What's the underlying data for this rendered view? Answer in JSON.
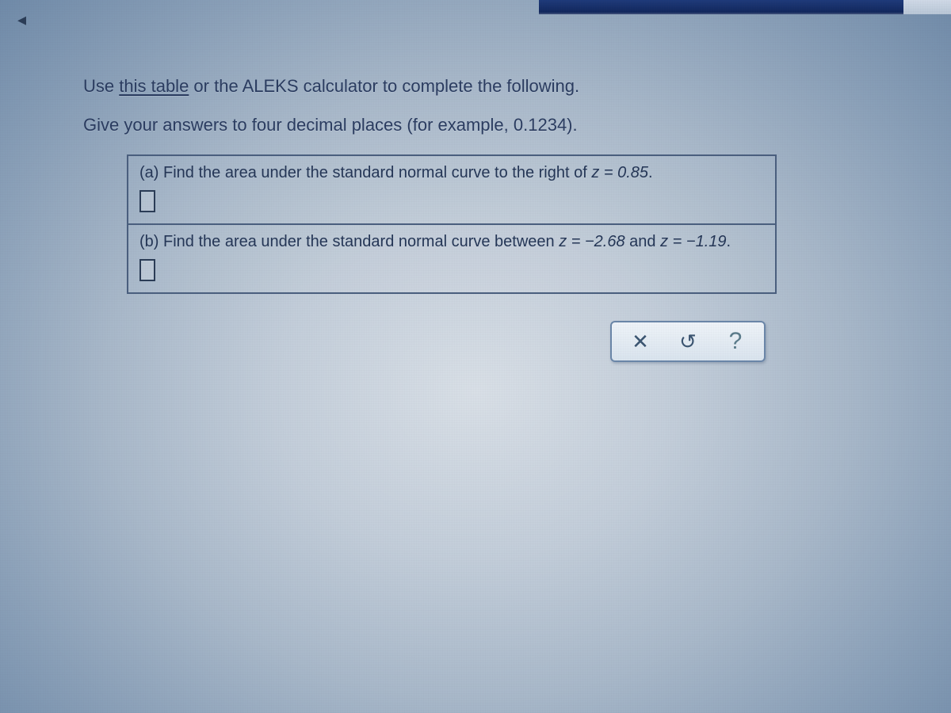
{
  "nav": {
    "back_icon": "◂"
  },
  "intro": {
    "line1_pre": "Use ",
    "link_text": "this table",
    "line1_post": " or the ALEKS calculator to complete the following.",
    "line2": "Give your answers to four decimal places (for example, 0.1234)."
  },
  "questions": [
    {
      "label": "(a)",
      "text_pre": " Find the area under the standard normal curve to the right of ",
      "z_expr": "z = 0.85",
      "text_post": "."
    },
    {
      "label": "(b)",
      "text_pre": " Find the area under the standard normal curve between ",
      "z_expr": "z = −2.68",
      "text_mid": " and ",
      "z_expr2": "z = −1.19",
      "text_post": "."
    }
  ],
  "controls": {
    "clear_icon": "✕",
    "reset_icon": "↺",
    "help_icon": "?"
  }
}
